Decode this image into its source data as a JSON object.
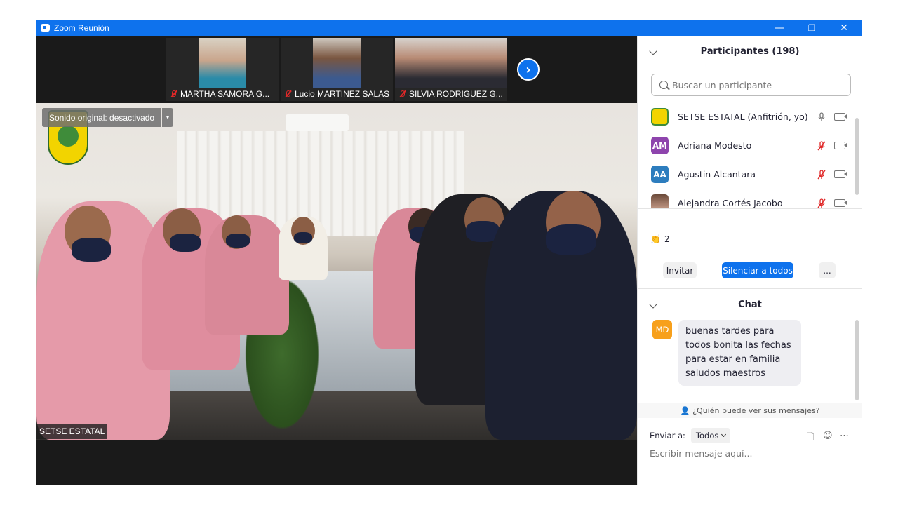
{
  "window": {
    "title": "Zoom Reunión",
    "accent": "#0e72ed",
    "controls": [
      "—",
      "❐",
      "✕"
    ]
  },
  "thumbnails": [
    {
      "name": "MARTHA SAMORA G...",
      "muted": true
    },
    {
      "name": "Lucio MARTINEZ SALAS",
      "muted": true
    },
    {
      "name": "SILVIA RODRIGUEZ G...",
      "muted": true
    }
  ],
  "main_video": {
    "sound_label": "Sonido original: desactivado",
    "speaker_name": "SETSE ESTATAL"
  },
  "participants": {
    "title": "Participantes (198)",
    "search_placeholder": "Buscar un participante",
    "list": [
      {
        "name": "SETSE ESTATAL (Anfitrión, yo)",
        "initials": "",
        "avatar_color": "#f2d400",
        "mic": "on"
      },
      {
        "name": "Adriana Modesto",
        "initials": "AM",
        "avatar_color": "#8e44ad",
        "mic": "muted"
      },
      {
        "name": "Agustin Alcantara",
        "initials": "AA",
        "avatar_color": "#2d7dbe",
        "mic": "muted"
      },
      {
        "name": "Alejandra Cortés Jacobo",
        "initials": "",
        "avatar_color": "#a0756a",
        "mic": "muted"
      }
    ],
    "reaction": {
      "icon": "👏",
      "count": "2"
    },
    "buttons": {
      "invite": "Invitar",
      "mute_all": "Silenciar a todos",
      "more": "..."
    }
  },
  "chat": {
    "title": "Chat",
    "messages": [
      {
        "initials": "MD",
        "text": "buenas tardes para todos bonita las fechas para estar en familia saludos maestros"
      }
    ],
    "who_can_see": "¿Quién puede ver sus mensajes?",
    "send_to_label": "Enviar a:",
    "send_to_value": "Todos",
    "input_placeholder": "Escribir mensaje aquí...",
    "tool_icons": [
      "file-icon",
      "emoji-icon",
      "more-icon"
    ]
  }
}
